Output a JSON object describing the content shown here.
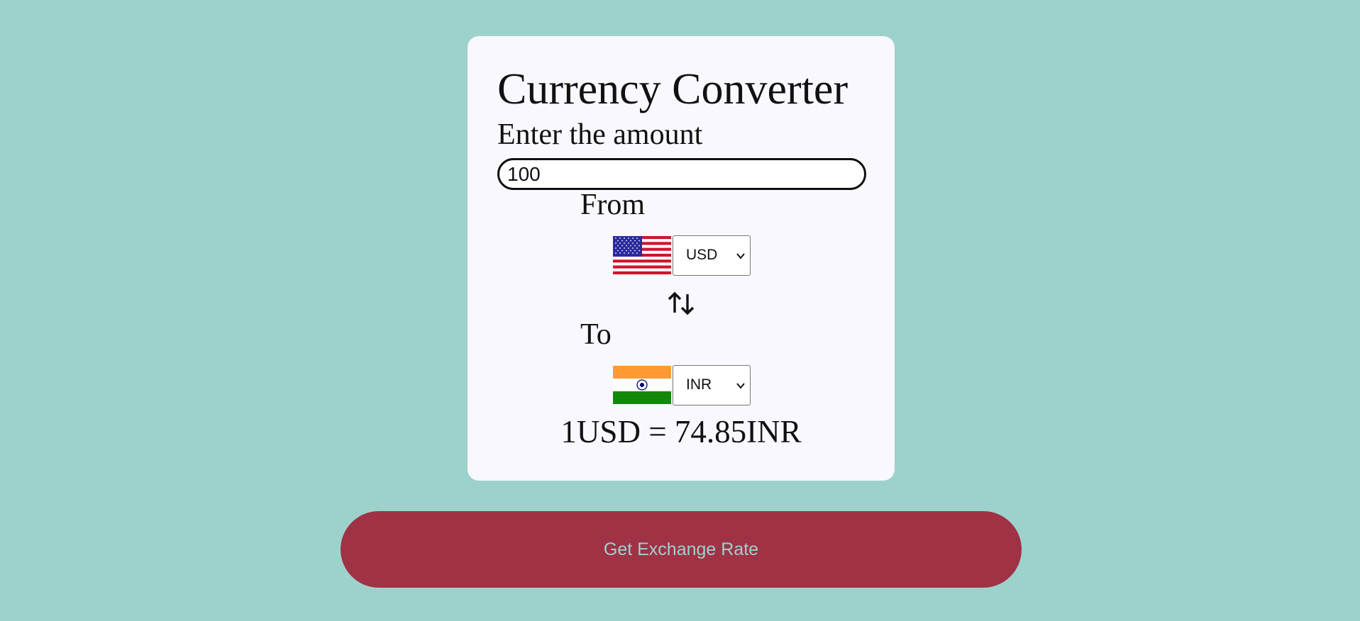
{
  "app": {
    "title": "Currency Converter"
  },
  "amount": {
    "label": "Enter the amount",
    "value": "100"
  },
  "from": {
    "label": "From",
    "currency": "USD",
    "flag_icon": "us-flag-icon"
  },
  "to": {
    "label": "To",
    "currency": "INR",
    "flag_icon": "india-flag-icon"
  },
  "swap_icon": "swap-arrows-icon",
  "result": {
    "text": "1USD = 74.85INR"
  },
  "button": {
    "label": "Get Exchange Rate"
  },
  "colors": {
    "background": "#9dd2cc",
    "card": "#f9f8fe",
    "button": "#a03246",
    "button_text": "#9dd2cc"
  }
}
